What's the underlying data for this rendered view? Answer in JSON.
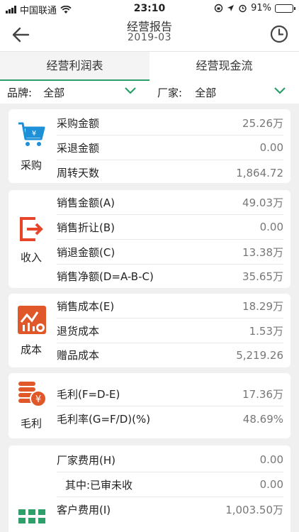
{
  "status": {
    "carrier": "中国联通",
    "time": "23:10",
    "battery": "91%",
    "battery_level": 0.91
  },
  "nav": {
    "title": "经营报告",
    "subtitle": "2019-03"
  },
  "tabs": [
    {
      "label": "经营利润表",
      "active": true
    },
    {
      "label": "经营现金流",
      "active": false
    }
  ],
  "filters": {
    "brand": {
      "label": "品牌:",
      "value": "全部"
    },
    "vendor": {
      "label": "厂家:",
      "value": "全部"
    }
  },
  "colors": {
    "accent_green": "#2e9e6a",
    "icon_blue": "#1e90d8",
    "icon_red": "#e8452a",
    "icon_orange": "#e0582a"
  },
  "sections": {
    "purchase": {
      "label": "采购",
      "rows": [
        {
          "label": "采购金额",
          "value": "25.26万"
        },
        {
          "label": "采退金额",
          "value": "0.00"
        },
        {
          "label": "周转天数",
          "value": "1,864.72"
        }
      ]
    },
    "income": {
      "label": "收入",
      "rows": [
        {
          "label": "销售金额(A)",
          "value": "49.03万"
        },
        {
          "label": "销售折让(B)",
          "value": "0.00"
        },
        {
          "label": "销退金额(C)",
          "value": "13.38万"
        },
        {
          "label": "销售净额(D=A-B-C)",
          "value": "35.65万"
        }
      ]
    },
    "cost": {
      "label": "成本",
      "rows": [
        {
          "label": "销售成本(E)",
          "value": "18.29万"
        },
        {
          "label": "退货成本",
          "value": "1.53万"
        },
        {
          "label": "赠品成本",
          "value": "5,219.26"
        }
      ]
    },
    "gross": {
      "label": "毛利",
      "rows": [
        {
          "label": "毛利(F=D-E)",
          "value": "17.36万"
        },
        {
          "label": "毛利率(G=F/D)(%)",
          "value": "48.69%"
        }
      ]
    },
    "expense": {
      "rows": [
        {
          "label": "厂家费用(H)",
          "value": "0.00"
        },
        {
          "label": "其中:已审未收",
          "value": "0.00"
        },
        {
          "label": "客户费用(I)",
          "value": "1,003.50万"
        }
      ]
    }
  }
}
